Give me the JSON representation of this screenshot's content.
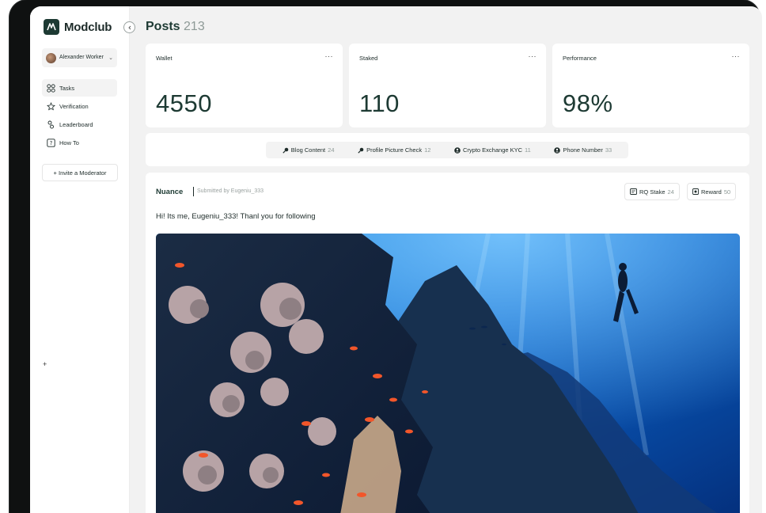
{
  "app": {
    "brand": "Modclub"
  },
  "user": {
    "name": "Alexander Worker"
  },
  "sidebar": {
    "items": [
      {
        "label": "Tasks",
        "icon": "tasks-icon"
      },
      {
        "label": "Verification",
        "icon": "verification-icon"
      },
      {
        "label": "Leaderboard",
        "icon": "leaderboard-icon"
      },
      {
        "label": "How To",
        "icon": "help-icon"
      }
    ],
    "invite_label": "+ Invite a Moderator",
    "add_label": "+"
  },
  "page": {
    "title": "Posts",
    "count": "213"
  },
  "stats": [
    {
      "label": "Wallet",
      "value": "4550",
      "menu": "···"
    },
    {
      "label": "Staked",
      "value": "110",
      "menu": "···"
    },
    {
      "label": "Performance",
      "value": "98%",
      "menu": "···"
    }
  ],
  "filters": [
    {
      "label": "Blog Content",
      "count": "24",
      "icon": "search-icon"
    },
    {
      "label": "Profile Picture Check",
      "count": "12",
      "icon": "search-icon"
    },
    {
      "label": "Crypto Exchange KYC",
      "count": "11",
      "icon": "user-circle-icon"
    },
    {
      "label": "Phone Number",
      "count": "33",
      "icon": "user-circle-icon"
    }
  ],
  "post": {
    "author": "Nuance",
    "submitted_by": "Submitted by Eugeniu_333",
    "text": "Hi! Its me, Eugeniu_333! Thanl you for following",
    "stake_label": "RQ Stake",
    "stake_value": "24",
    "reward_label": "Reward",
    "reward_value": "50"
  },
  "colors": {
    "brand_dark": "#1d3a33",
    "muted": "#8e9a97",
    "background": "#f2f2f2",
    "ocean_blue": "#0a5fc2"
  }
}
